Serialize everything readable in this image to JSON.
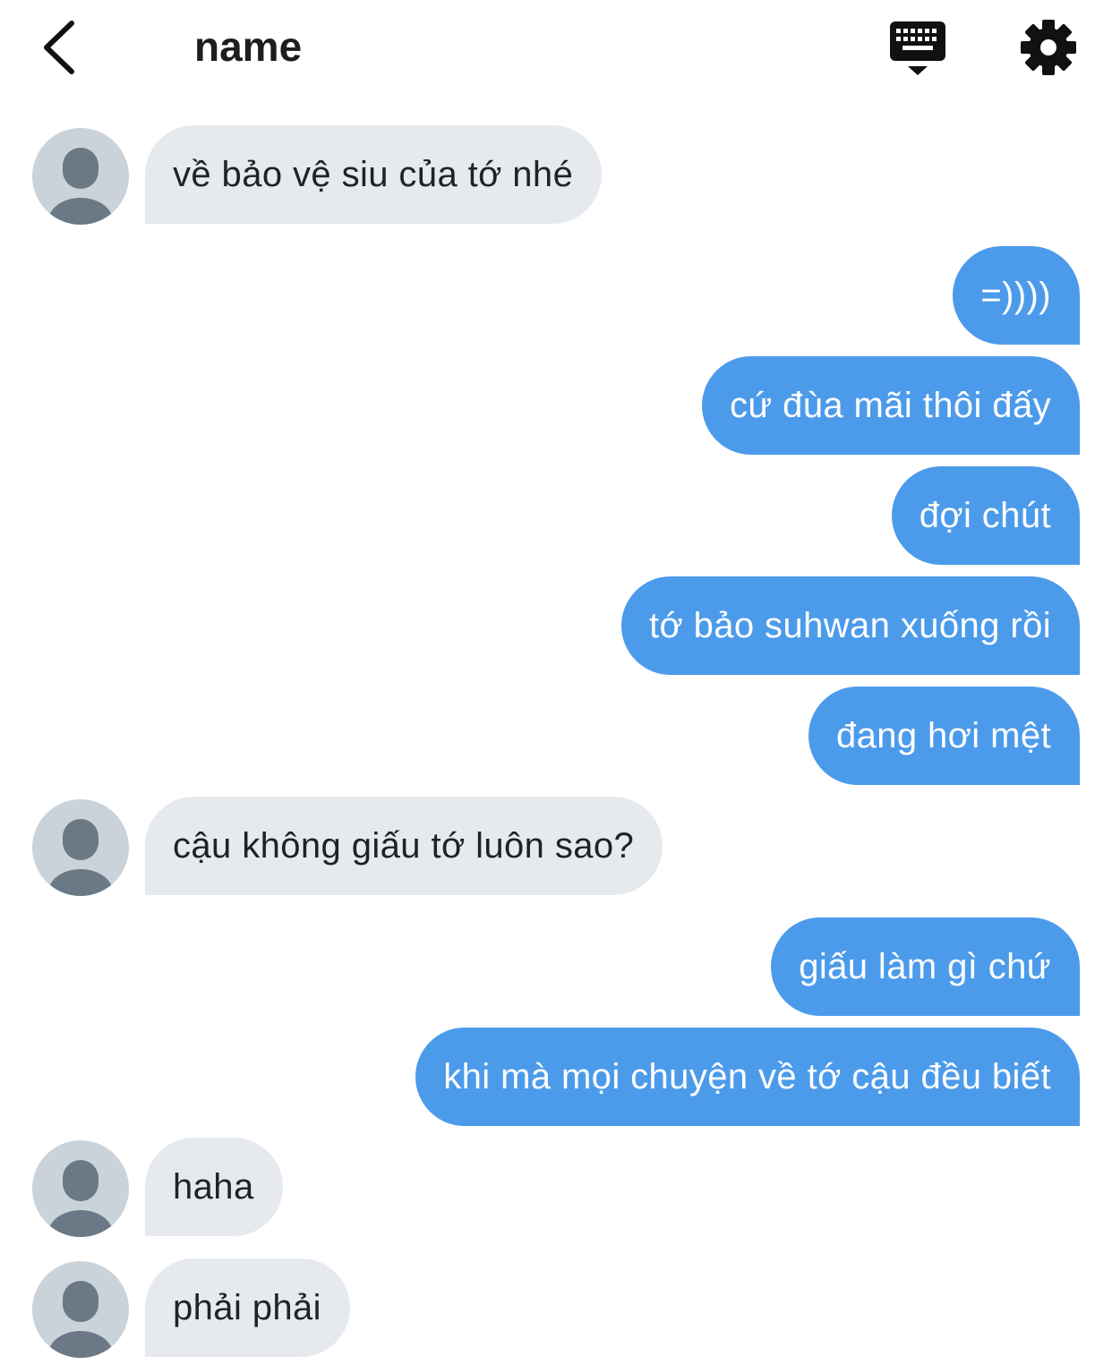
{
  "header": {
    "title": "name",
    "back_icon": "chevron-left-icon",
    "keyboard_icon": "keyboard-icon",
    "settings_icon": "gear-icon"
  },
  "colors": {
    "incoming_bubble": "#e6eaee",
    "outgoing_bubble": "#4c9beb",
    "avatar_bg": "#cbd3da",
    "avatar_fg": "#6b7886"
  },
  "messages": [
    {
      "side": "in",
      "text": "về bảo vệ siu của tớ nhé"
    },
    {
      "side": "out",
      "text": "=))))"
    },
    {
      "side": "out",
      "text": "cứ đùa mãi thôi đấy"
    },
    {
      "side": "out",
      "text": "đợi chút"
    },
    {
      "side": "out",
      "text": "tớ bảo suhwan xuống rồi"
    },
    {
      "side": "out",
      "text": "đang hơi mệt"
    },
    {
      "side": "in",
      "text": "cậu không giấu tớ luôn sao?"
    },
    {
      "side": "out",
      "text": "giấu làm gì chứ"
    },
    {
      "side": "out",
      "text": "khi mà mọi chuyện về tớ cậu đều biết"
    },
    {
      "side": "in",
      "text": "haha"
    },
    {
      "side": "in",
      "text": "phải phải"
    }
  ]
}
